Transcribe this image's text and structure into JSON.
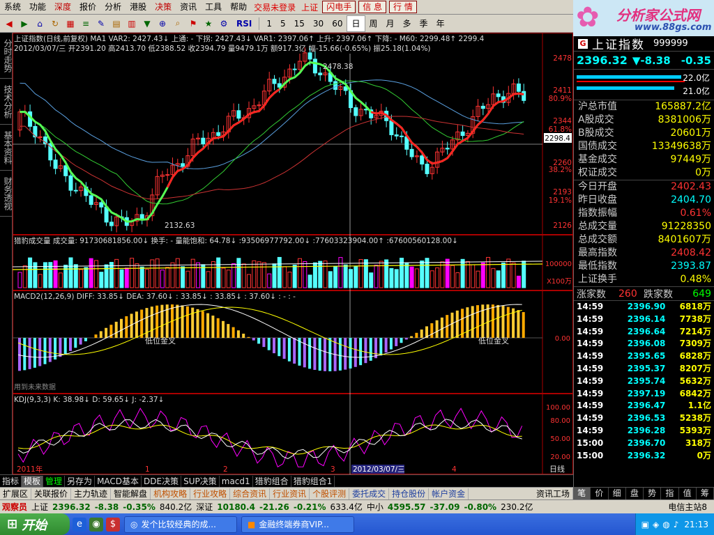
{
  "menubar": {
    "items": [
      "系统",
      "功能",
      "深度",
      "报价",
      "分析",
      "港股",
      "决策",
      "资讯",
      "工具",
      "帮助"
    ],
    "highlight": [
      2,
      6
    ],
    "status": "交易未登录",
    "status2": "上证",
    "buttons": [
      "闪电手",
      "信 息",
      "行 情"
    ]
  },
  "toolbar": {
    "periods": [
      "1",
      "5",
      "15",
      "30",
      "60",
      "日",
      "周",
      "月",
      "多",
      "季",
      "年"
    ],
    "selected": "日",
    "rsi_label": "RSI"
  },
  "logo": {
    "title": "分析家公式网",
    "url": "www.88gs.com"
  },
  "lefttabs": [
    "分时走势",
    "技术分析",
    "基本资料",
    "财务透视"
  ],
  "main": {
    "title_line": "上证指数(日线,前复权) MA1  VAR2: 2427.43↓  上通: - 下拐: 2427.43↓  VAR1: 2397.06↑  上升: 2397.06↑  下降: - M60: 2299.48↑ 2299.4",
    "ohlc_line": "2012/03/07/三 开2391.20 高2413.70 低2388.52 收2394.79 量9479.1万 额917.3亿 幅-15.66(-0.65%) 振25.18(1.04%)",
    "price_axis": [
      "2478",
      "2411",
      "80.9%",
      "2344",
      "61.8%",
      "2260",
      "38.2%",
      "2193",
      "19.1%",
      "2126"
    ],
    "current_price_tag": "2298.4",
    "label_high": "2478.38",
    "label_low": "2132.63",
    "vol_title": "猎豹成交量  成交量: 91730681856.00↓  换手: - 量能饱和: 64.78↓ :93506977792.00↓ :77603323904.00↑ :67600560128.00↓",
    "vol_axis": [
      "100000",
      "X100万"
    ],
    "macd_title": "MACD2(12,26,9)  DIFF: 33.85↓  DEA: 37.60↓  : 33.85↓  : 33.85↓  : 37.60↓  : - : -",
    "macd_axis": [
      "0.00"
    ],
    "macd_labels": [
      "低位金叉",
      "低位金叉"
    ],
    "macd_note": "用到未来数据",
    "kdj_title": "KDJ(9,3,3)  K: 38.98↓  D: 59.65↓  J: -2.37↓",
    "kdj_axis": [
      "100.00",
      "80.00",
      "50.00",
      "20.00"
    ],
    "date_axis": [
      "2011年",
      "1",
      "2",
      "3",
      "2012/03/07/三",
      "4"
    ],
    "period_label": "日线"
  },
  "bottomtabs": {
    "items": [
      "指标",
      "模板",
      "管理",
      "另存为",
      "MACD基本",
      "DDE决策",
      "SUP决策",
      "macd1",
      "猎豹组合",
      "猎豹组合1"
    ],
    "active": "模板",
    "green": "管理"
  },
  "funcbar": {
    "items": [
      "扩展区",
      "关联报价",
      "主力轨迹",
      "智能解盘",
      "机构攻略",
      "行业攻略",
      "综合资讯",
      "行业资讯",
      "个股评测",
      "委托成交",
      "持仓股份",
      "帐户资金"
    ],
    "right": "资讯工场"
  },
  "rightpanel": {
    "g_badge": "G",
    "name": "上证指数",
    "code": "999999",
    "price": "2396.32",
    "change": "▼-8.38",
    "pct": "-0.35",
    "bar_labels": [
      "22.0亿",
      "21.0亿"
    ],
    "rows1": [
      [
        "沪总市值",
        "165887.2亿"
      ],
      [
        "A股成交",
        "8381006万"
      ],
      [
        "B股成交",
        "20601万"
      ],
      [
        "国债成交",
        "13349638万"
      ],
      [
        "基金成交",
        "97449万"
      ],
      [
        "权证成交",
        "0万"
      ]
    ],
    "rows2": [
      [
        "今日开盘",
        "2402.43"
      ],
      [
        "昨日收盘",
        "2404.70"
      ],
      [
        "指数振幅",
        "0.61%"
      ],
      [
        "总成交量",
        "91228350"
      ],
      [
        "总成交额",
        "8401607万"
      ],
      [
        "最高指数",
        "2408.42"
      ],
      [
        "最低指数",
        "2393.87"
      ],
      [
        "上证换手",
        "0.48%"
      ]
    ],
    "up_label": "涨家数",
    "up_count": "260",
    "down_label": "跌家数",
    "down_count": "649",
    "ticks": [
      [
        "14:59",
        "2396.90",
        "6818万"
      ],
      [
        "14:59",
        "2396.14",
        "7738万"
      ],
      [
        "14:59",
        "2396.64",
        "7214万"
      ],
      [
        "14:59",
        "2396.08",
        "7309万"
      ],
      [
        "14:59",
        "2395.65",
        "6828万"
      ],
      [
        "14:59",
        "2395.37",
        "8207万"
      ],
      [
        "14:59",
        "2395.74",
        "5632万"
      ],
      [
        "14:59",
        "2397.19",
        "6842万"
      ],
      [
        "14:59",
        "2396.47",
        "1.1亿"
      ],
      [
        "14:59",
        "2396.53",
        "5238万"
      ],
      [
        "14:59",
        "2396.28",
        "5393万"
      ],
      [
        "15:00",
        "2396.70",
        "318万"
      ],
      [
        "15:00",
        "2396.32",
        "0万"
      ]
    ]
  },
  "rptabs": [
    "笔",
    "价",
    "细",
    "盘",
    "势",
    "指",
    "值",
    "筹"
  ],
  "statusbar": {
    "guest": "观察员",
    "sh_label": "上证",
    "sh_price": "2396.32",
    "sh_chg": "-8.38",
    "sh_pct": "-0.35%",
    "sh_amt": "840.2亿",
    "sz_label": "深证",
    "sz_price": "10180.4",
    "sz_chg": "-21.26",
    "sz_pct": "-0.21%",
    "sz_amt": "633.4亿",
    "zx_label": "中小",
    "zx_price": "4595.57",
    "zx_chg": "-37.09",
    "zx_pct": "-0.80%",
    "zx_amt": "230.2亿",
    "server": "电信主站8"
  },
  "taskbar": {
    "start": "开始",
    "tasks": [
      "发个比较经典的成...",
      "金融终端券商VIP..."
    ],
    "time": "21:13"
  }
}
